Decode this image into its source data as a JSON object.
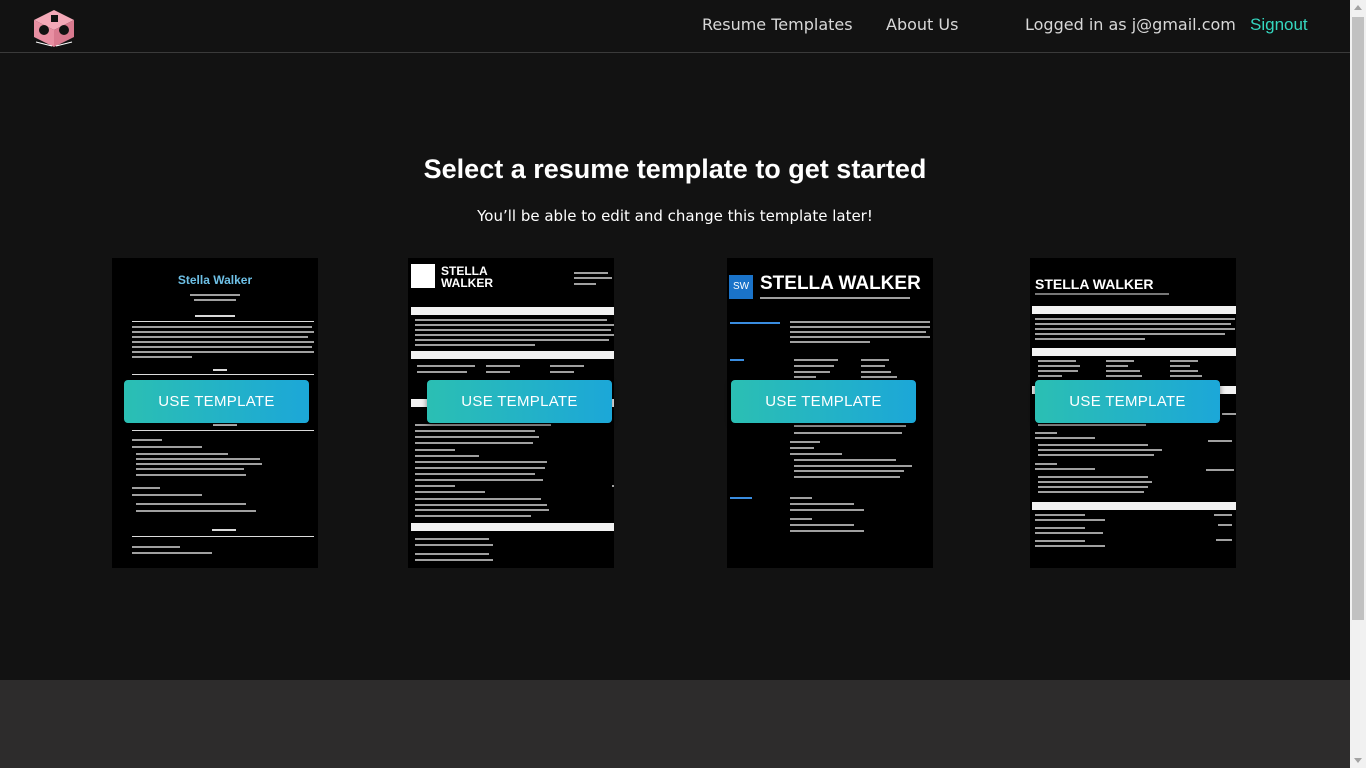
{
  "header": {
    "nav_templates": "Resume Templates",
    "nav_about": "About Us",
    "logged_in": "Logged in as j@gmail.com",
    "signout": "Signout"
  },
  "main": {
    "title": "Select a resume template to get started",
    "subtitle": "You’ll be able to edit and change this template later!"
  },
  "templates": [
    {
      "name": "Stella Walker",
      "button": "USE TEMPLATE"
    },
    {
      "name": "STELLA WALKER",
      "button": "USE TEMPLATE"
    },
    {
      "name": "STELLA WALKER",
      "badge": "SW",
      "button": "USE TEMPLATE"
    },
    {
      "name": "STELLA WALKER",
      "button": "USE TEMPLATE"
    }
  ],
  "colors": {
    "accent_link": "#35d7c0",
    "button_start": "#2bbfb3",
    "button_end": "#1ca7d8",
    "background": "#121212",
    "footer": "#2d2c2c"
  }
}
